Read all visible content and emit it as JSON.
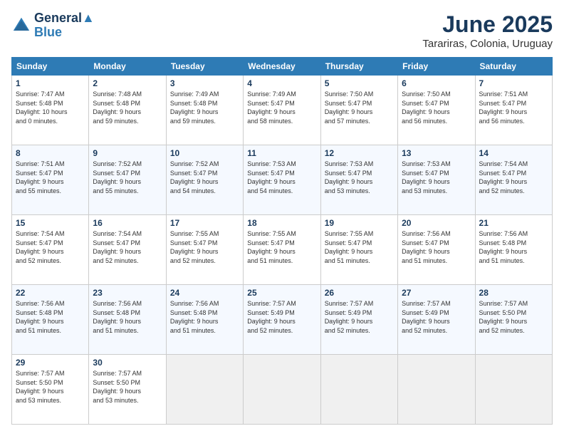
{
  "logo": {
    "line1": "General",
    "line2": "Blue"
  },
  "title": "June 2025",
  "subtitle": "Tarariras, Colonia, Uruguay",
  "days_of_week": [
    "Sunday",
    "Monday",
    "Tuesday",
    "Wednesday",
    "Thursday",
    "Friday",
    "Saturday"
  ],
  "weeks": [
    [
      {
        "day": "1",
        "info": "Sunrise: 7:47 AM\nSunset: 5:48 PM\nDaylight: 10 hours\nand 0 minutes."
      },
      {
        "day": "2",
        "info": "Sunrise: 7:48 AM\nSunset: 5:48 PM\nDaylight: 9 hours\nand 59 minutes."
      },
      {
        "day": "3",
        "info": "Sunrise: 7:49 AM\nSunset: 5:48 PM\nDaylight: 9 hours\nand 59 minutes."
      },
      {
        "day": "4",
        "info": "Sunrise: 7:49 AM\nSunset: 5:47 PM\nDaylight: 9 hours\nand 58 minutes."
      },
      {
        "day": "5",
        "info": "Sunrise: 7:50 AM\nSunset: 5:47 PM\nDaylight: 9 hours\nand 57 minutes."
      },
      {
        "day": "6",
        "info": "Sunrise: 7:50 AM\nSunset: 5:47 PM\nDaylight: 9 hours\nand 56 minutes."
      },
      {
        "day": "7",
        "info": "Sunrise: 7:51 AM\nSunset: 5:47 PM\nDaylight: 9 hours\nand 56 minutes."
      }
    ],
    [
      {
        "day": "8",
        "info": "Sunrise: 7:51 AM\nSunset: 5:47 PM\nDaylight: 9 hours\nand 55 minutes."
      },
      {
        "day": "9",
        "info": "Sunrise: 7:52 AM\nSunset: 5:47 PM\nDaylight: 9 hours\nand 55 minutes."
      },
      {
        "day": "10",
        "info": "Sunrise: 7:52 AM\nSunset: 5:47 PM\nDaylight: 9 hours\nand 54 minutes."
      },
      {
        "day": "11",
        "info": "Sunrise: 7:53 AM\nSunset: 5:47 PM\nDaylight: 9 hours\nand 54 minutes."
      },
      {
        "day": "12",
        "info": "Sunrise: 7:53 AM\nSunset: 5:47 PM\nDaylight: 9 hours\nand 53 minutes."
      },
      {
        "day": "13",
        "info": "Sunrise: 7:53 AM\nSunset: 5:47 PM\nDaylight: 9 hours\nand 53 minutes."
      },
      {
        "day": "14",
        "info": "Sunrise: 7:54 AM\nSunset: 5:47 PM\nDaylight: 9 hours\nand 52 minutes."
      }
    ],
    [
      {
        "day": "15",
        "info": "Sunrise: 7:54 AM\nSunset: 5:47 PM\nDaylight: 9 hours\nand 52 minutes."
      },
      {
        "day": "16",
        "info": "Sunrise: 7:54 AM\nSunset: 5:47 PM\nDaylight: 9 hours\nand 52 minutes."
      },
      {
        "day": "17",
        "info": "Sunrise: 7:55 AM\nSunset: 5:47 PM\nDaylight: 9 hours\nand 52 minutes."
      },
      {
        "day": "18",
        "info": "Sunrise: 7:55 AM\nSunset: 5:47 PM\nDaylight: 9 hours\nand 51 minutes."
      },
      {
        "day": "19",
        "info": "Sunrise: 7:55 AM\nSunset: 5:47 PM\nDaylight: 9 hours\nand 51 minutes."
      },
      {
        "day": "20",
        "info": "Sunrise: 7:56 AM\nSunset: 5:47 PM\nDaylight: 9 hours\nand 51 minutes."
      },
      {
        "day": "21",
        "info": "Sunrise: 7:56 AM\nSunset: 5:48 PM\nDaylight: 9 hours\nand 51 minutes."
      }
    ],
    [
      {
        "day": "22",
        "info": "Sunrise: 7:56 AM\nSunset: 5:48 PM\nDaylight: 9 hours\nand 51 minutes."
      },
      {
        "day": "23",
        "info": "Sunrise: 7:56 AM\nSunset: 5:48 PM\nDaylight: 9 hours\nand 51 minutes."
      },
      {
        "day": "24",
        "info": "Sunrise: 7:56 AM\nSunset: 5:48 PM\nDaylight: 9 hours\nand 51 minutes."
      },
      {
        "day": "25",
        "info": "Sunrise: 7:57 AM\nSunset: 5:49 PM\nDaylight: 9 hours\nand 52 minutes."
      },
      {
        "day": "26",
        "info": "Sunrise: 7:57 AM\nSunset: 5:49 PM\nDaylight: 9 hours\nand 52 minutes."
      },
      {
        "day": "27",
        "info": "Sunrise: 7:57 AM\nSunset: 5:49 PM\nDaylight: 9 hours\nand 52 minutes."
      },
      {
        "day": "28",
        "info": "Sunrise: 7:57 AM\nSunset: 5:50 PM\nDaylight: 9 hours\nand 52 minutes."
      }
    ],
    [
      {
        "day": "29",
        "info": "Sunrise: 7:57 AM\nSunset: 5:50 PM\nDaylight: 9 hours\nand 53 minutes."
      },
      {
        "day": "30",
        "info": "Sunrise: 7:57 AM\nSunset: 5:50 PM\nDaylight: 9 hours\nand 53 minutes."
      },
      {
        "day": "",
        "info": ""
      },
      {
        "day": "",
        "info": ""
      },
      {
        "day": "",
        "info": ""
      },
      {
        "day": "",
        "info": ""
      },
      {
        "day": "",
        "info": ""
      }
    ]
  ]
}
